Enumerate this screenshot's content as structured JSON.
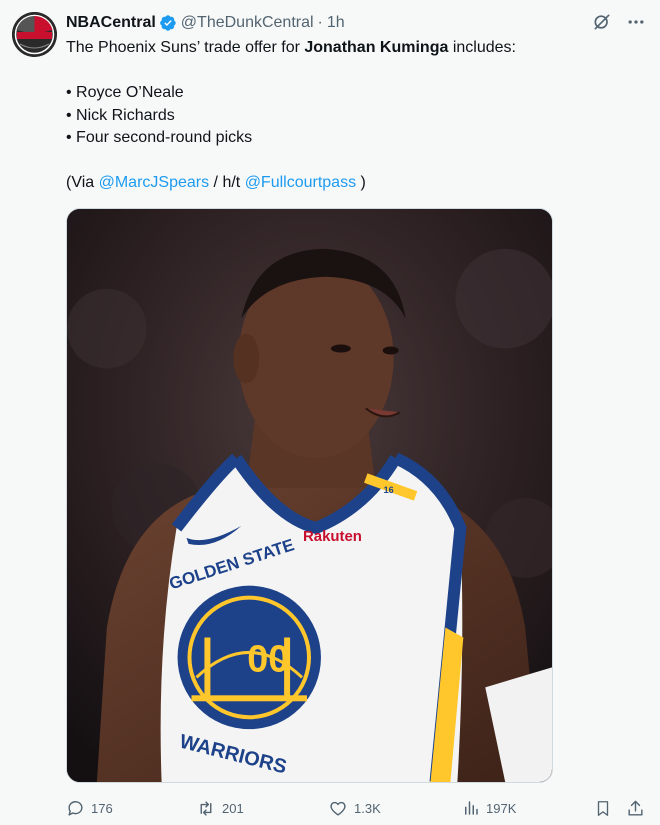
{
  "author": {
    "display_name": "NBACentral",
    "handle": "@TheDunkCentral",
    "separator": "·",
    "time": "1h",
    "avatar_text": "CENTRAL"
  },
  "tweet": {
    "intro_prefix": "The Phoenix Suns’ trade offer for ",
    "intro_bold": "Jonathan Kuminga",
    "intro_suffix": " includes:",
    "bullets": [
      "• Royce O’Neale",
      "• Nick Richards",
      "• Four second-round picks"
    ],
    "via_prefix": "(Via ",
    "via_mention_1": "@MarcJSpears",
    "via_middle": " / h/t ",
    "via_mention_2": "@Fullcourtpass",
    "via_suffix": " )"
  },
  "media": {
    "jersey_brand": "Rakuten",
    "jersey_team_top": "GOLDEN STATE",
    "jersey_team_bottom": "WARRIORS",
    "jersey_number": "00",
    "strap_number": "16"
  },
  "actions": {
    "replies": "176",
    "reposts": "201",
    "likes": "1.3K",
    "views": "197K"
  },
  "icons": {
    "verified": "verified-badge-icon",
    "grok": "grok-icon",
    "more": "more-icon",
    "reply": "reply-icon",
    "repost": "repost-icon",
    "like": "heart-icon",
    "views": "views-icon",
    "bookmark": "bookmark-icon",
    "share": "share-icon"
  },
  "colors": {
    "accent": "#1d9bf0",
    "secondary_text": "#536471",
    "background": "#f7f9f9"
  }
}
